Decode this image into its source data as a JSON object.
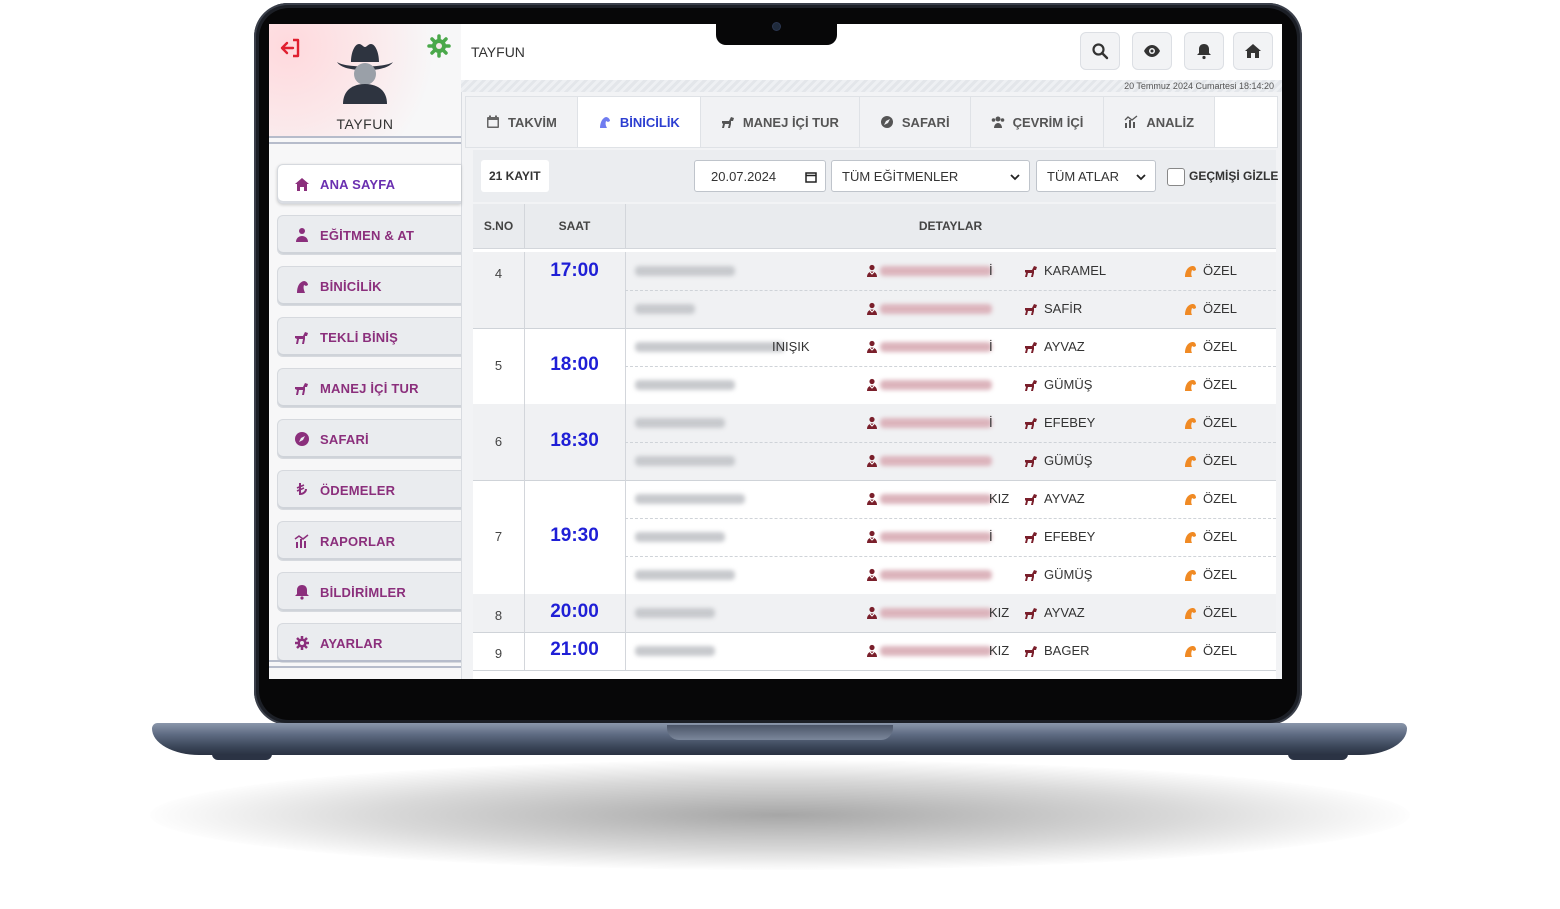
{
  "app": {
    "user_name": "TAYFUN",
    "top_title": "TAYFUN",
    "datetime": "20 Temmuz 2024 Cumartesi 18:14:20"
  },
  "sidebar": {
    "items": [
      {
        "label": "ANA SAYFA",
        "icon": "home-icon",
        "active": true
      },
      {
        "label": "EĞİTMEN & AT",
        "icon": "user-tie-icon",
        "active": false
      },
      {
        "label": "BİNİCİLİK",
        "icon": "horse-head-icon",
        "active": false
      },
      {
        "label": "TEKLİ BİNİŞ",
        "icon": "horse-icon",
        "active": false
      },
      {
        "label": "MANEJ İÇİ TUR",
        "icon": "horse-icon",
        "active": false
      },
      {
        "label": "SAFARİ",
        "icon": "compass-icon",
        "active": false
      },
      {
        "label": "ÖDEMELER",
        "icon": "lira-icon",
        "active": false
      },
      {
        "label": "RAPORLAR",
        "icon": "chart-icon",
        "active": false
      },
      {
        "label": "BİLDİRİMLER",
        "icon": "bell-icon",
        "active": false
      },
      {
        "label": "AYARLAR",
        "icon": "gear-icon",
        "active": false
      }
    ]
  },
  "toolbar": {
    "buttons": [
      "search-icon",
      "eye-icon",
      "bell-icon",
      "home-icon"
    ]
  },
  "tabs": [
    {
      "label": "TAKVİM",
      "icon": "calendar-icon",
      "active": false
    },
    {
      "label": "BİNİCİLİK",
      "icon": "horse-head-icon",
      "active": true
    },
    {
      "label": "MANEJ İÇİ TUR",
      "icon": "horse-icon",
      "active": false
    },
    {
      "label": "SAFARİ",
      "icon": "compass-icon",
      "active": false
    },
    {
      "label": "ÇEVRİM İÇİ",
      "icon": "users-icon",
      "active": false
    },
    {
      "label": "ANALİZ",
      "icon": "chart-icon",
      "active": false
    }
  ],
  "filters": {
    "count_label": "21 KAYIT",
    "date_value": "20.07.2024",
    "instructor_select": "TÜM EĞİTMENLER",
    "horse_select": "TÜM ATLAR",
    "hide_past_label": "GEÇMİŞİ GİZLE"
  },
  "table": {
    "headers": {
      "sno": "S.NO",
      "saat": "SAAT",
      "detaylar": "DETAYLAR"
    },
    "groups": [
      {
        "sno": "4",
        "saat": "17:00",
        "rows": [
          {
            "rider_suffix": "",
            "instr_suffix": "İ",
            "horse": "KARAMEL",
            "type": "ÖZEL"
          },
          {
            "rider_suffix": "",
            "instr_suffix": "",
            "horse": "SAFİR",
            "type": "ÖZEL"
          }
        ]
      },
      {
        "sno": "5",
        "saat": "18:00",
        "rows": [
          {
            "rider_suffix": "INIŞIK",
            "instr_suffix": "İ",
            "horse": "AYVAZ",
            "type": "ÖZEL"
          },
          {
            "rider_suffix": "",
            "instr_suffix": "",
            "horse": "GÜMÜŞ",
            "type": "ÖZEL"
          }
        ]
      },
      {
        "sno": "6",
        "saat": "18:30",
        "rows": [
          {
            "rider_suffix": "",
            "instr_suffix": "İ",
            "horse": "EFEBEY",
            "type": "ÖZEL"
          },
          {
            "rider_suffix": "",
            "instr_suffix": "",
            "horse": "GÜMÜŞ",
            "type": "ÖZEL"
          }
        ]
      },
      {
        "sno": "7",
        "saat": "19:30",
        "rows": [
          {
            "rider_suffix": "",
            "instr_suffix": "KIZ",
            "horse": "AYVAZ",
            "type": "ÖZEL"
          },
          {
            "rider_suffix": "",
            "instr_suffix": "İ",
            "horse": "EFEBEY",
            "type": "ÖZEL"
          },
          {
            "rider_suffix": "",
            "instr_suffix": "",
            "horse": "GÜMÜŞ",
            "type": "ÖZEL"
          }
        ]
      },
      {
        "sno": "8",
        "saat": "20:00",
        "rows": [
          {
            "rider_suffix": "",
            "instr_suffix": "KIZ",
            "horse": "AYVAZ",
            "type": "ÖZEL"
          }
        ]
      },
      {
        "sno": "9",
        "saat": "21:00",
        "rows": [
          {
            "rider_suffix": "",
            "instr_suffix": "KIZ",
            "horse": "BAGER",
            "type": "ÖZEL"
          }
        ]
      }
    ]
  },
  "colors": {
    "menu_text": "#8b2f7c",
    "active_tab": "#2d3fd1",
    "time_blue": "#1f1fd6",
    "instructor_icon": "#7a1f2b",
    "horse_icon": "#7a1f2b",
    "type_icon": "#f08a24"
  }
}
